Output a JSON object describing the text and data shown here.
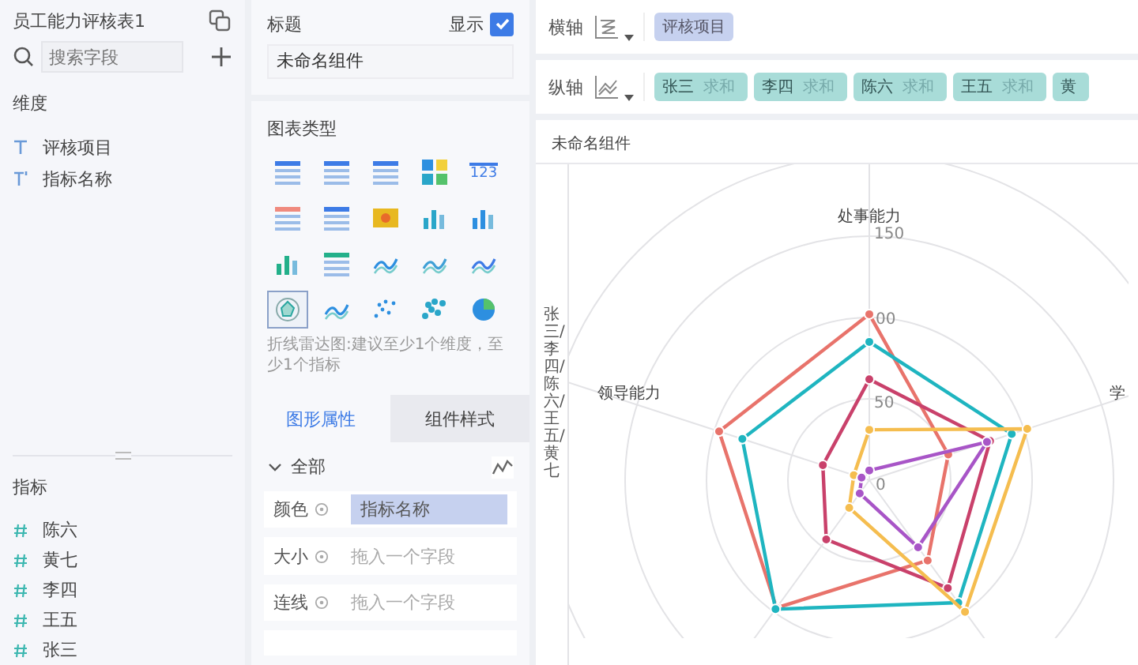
{
  "sidebar": {
    "title": "员工能力评核表1",
    "search": {
      "placeholder": "搜索字段"
    },
    "dimensions": {
      "heading": "维度",
      "items": [
        {
          "label": "评核项目",
          "kind": "text"
        },
        {
          "label": "指标名称",
          "kind": "text-derived"
        }
      ]
    },
    "measures": {
      "heading": "指标",
      "items": [
        {
          "label": "陈六",
          "kind": "number"
        },
        {
          "label": "黄七",
          "kind": "number"
        },
        {
          "label": "李四",
          "kind": "number"
        },
        {
          "label": "王五",
          "kind": "number"
        },
        {
          "label": "张三",
          "kind": "number"
        }
      ]
    }
  },
  "settings": {
    "title_label": "标题",
    "show_label": "显示",
    "show_checked": true,
    "title_value": "未命名组件",
    "chart_type_heading": "图表类型",
    "chart_types": [
      {
        "kind": "table",
        "selected": false
      },
      {
        "kind": "cross-table",
        "selected": false
      },
      {
        "kind": "grid-table",
        "selected": false
      },
      {
        "kind": "blocks",
        "selected": false
      },
      {
        "kind": "number",
        "label": "123",
        "selected": false
      },
      {
        "kind": "color-table",
        "selected": false
      },
      {
        "kind": "dot-table",
        "selected": false
      },
      {
        "kind": "heatmap",
        "selected": false
      },
      {
        "kind": "range-bars",
        "selected": false
      },
      {
        "kind": "column-small",
        "selected": false
      },
      {
        "kind": "column",
        "selected": false
      },
      {
        "kind": "bar",
        "selected": false
      },
      {
        "kind": "step",
        "selected": false
      },
      {
        "kind": "waves",
        "selected": false
      },
      {
        "kind": "line-area",
        "selected": false
      },
      {
        "kind": "radar",
        "selected": true
      },
      {
        "kind": "area",
        "selected": false
      },
      {
        "kind": "scatter",
        "selected": false
      },
      {
        "kind": "bubble",
        "selected": false
      },
      {
        "kind": "pie",
        "selected": false
      }
    ],
    "hint": "折线雷达图:建议至少1个维度，至少1个指标",
    "tabs": [
      {
        "label": "图形属性",
        "selected": true
      },
      {
        "label": "组件样式",
        "selected": false
      }
    ],
    "group": {
      "label": "全部",
      "expanded": true
    },
    "properties": [
      {
        "label": "颜色",
        "value": "指标名称"
      },
      {
        "label": "大小",
        "placeholder": "拖入一个字段"
      },
      {
        "label": "连线",
        "placeholder": "拖入一个字段"
      }
    ]
  },
  "axes": {
    "x": {
      "label": "横轴",
      "fields": [
        {
          "name": "评核项目"
        }
      ]
    },
    "y": {
      "label": "纵轴",
      "fields": [
        {
          "name": "张三",
          "agg": "求和"
        },
        {
          "name": "李四",
          "agg": "求和"
        },
        {
          "name": "陈六",
          "agg": "求和"
        },
        {
          "name": "王五",
          "agg": "求和"
        },
        {
          "name": "黄"
        }
      ]
    }
  },
  "chart": {
    "title": "未命名组件",
    "y_title": "张三/李四/陈六/王五/黄七",
    "axis_labels": [
      "处事能力",
      "学",
      "领导能力"
    ],
    "ticks": [
      "150",
      "00",
      "50",
      "0"
    ]
  }
}
